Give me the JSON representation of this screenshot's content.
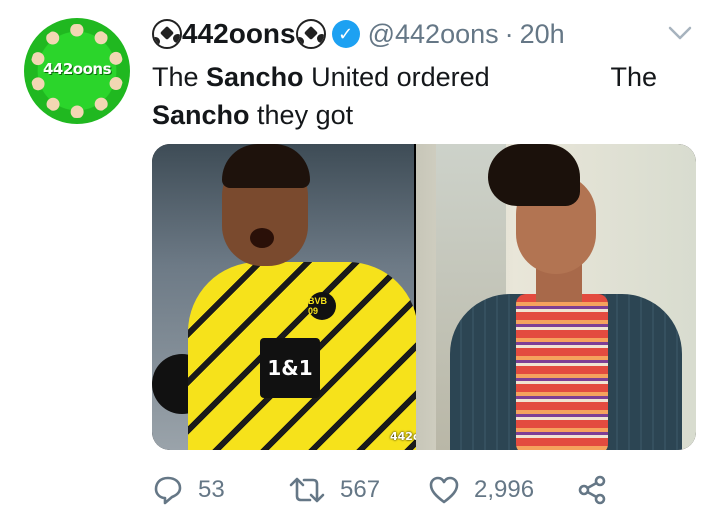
{
  "tweet": {
    "display_name": "442oons",
    "handle": "@442oons",
    "separator": "·",
    "time": "20h",
    "text_line1_a": "The ",
    "text_line1_b": "Sancho",
    "text_line1_c": " United ordered",
    "text_line1_d": "The",
    "text_line2_a": "Sancho",
    "text_line2_b": " they got",
    "avatar_text": "442oons",
    "media_left_sponsor": "1&1",
    "media_left_crest": "BVB 09",
    "media_watermark": "442oons"
  },
  "actions": {
    "replies": "53",
    "retweets": "567",
    "likes": "2,996"
  },
  "colors": {
    "verified": "#1da1f2",
    "muted": "#657786",
    "text": "#14171a"
  },
  "icons": [
    "soccer-ball-icon",
    "verified-badge-icon",
    "chevron-down-icon",
    "reply-icon",
    "retweet-icon",
    "like-icon",
    "share-icon"
  ]
}
